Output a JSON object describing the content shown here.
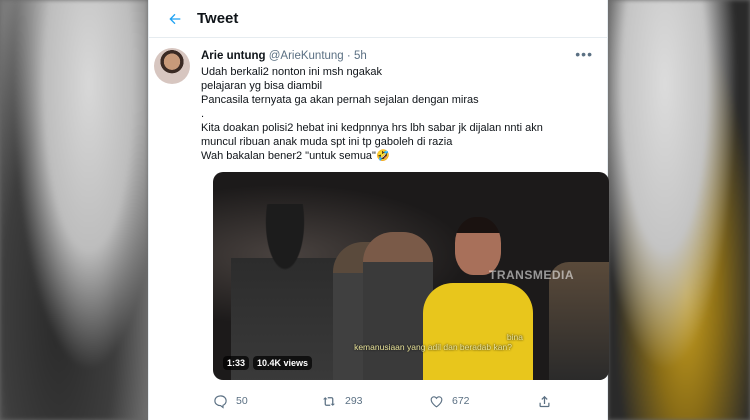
{
  "header": {
    "title": "Tweet"
  },
  "tweet": {
    "name": "Arie untung",
    "handle": "@ArieKuntung",
    "separator": "·",
    "time": "5h",
    "lines": [
      "Udah berkali2 nonton ini msh ngakak",
      "pelajaran yg bisa diambil",
      "Pancasila ternyata ga akan pernah sejalan dengan miras",
      ".",
      "Kita doakan polisi2 hebat ini kedpnnya hrs lbh sabar jk dijalan nnti akn",
      "muncul ribuan anak muda spt ini tp gaboleh di razia",
      "Wah bakalan bener2 \"untuk semua\"🤣"
    ],
    "media": {
      "watermark": "TRANSMEDIA",
      "subtitle_line1": "bina",
      "subtitle_line2": "kemanusiaan yang adil dan beradab kan?",
      "duration": "1:33",
      "views": "10.4K views"
    },
    "actions": {
      "replies": "50",
      "retweets": "293",
      "likes": "672"
    }
  },
  "colors": {
    "accent": "#1da1f2",
    "muted": "#5b7083",
    "text": "#0f1419"
  }
}
